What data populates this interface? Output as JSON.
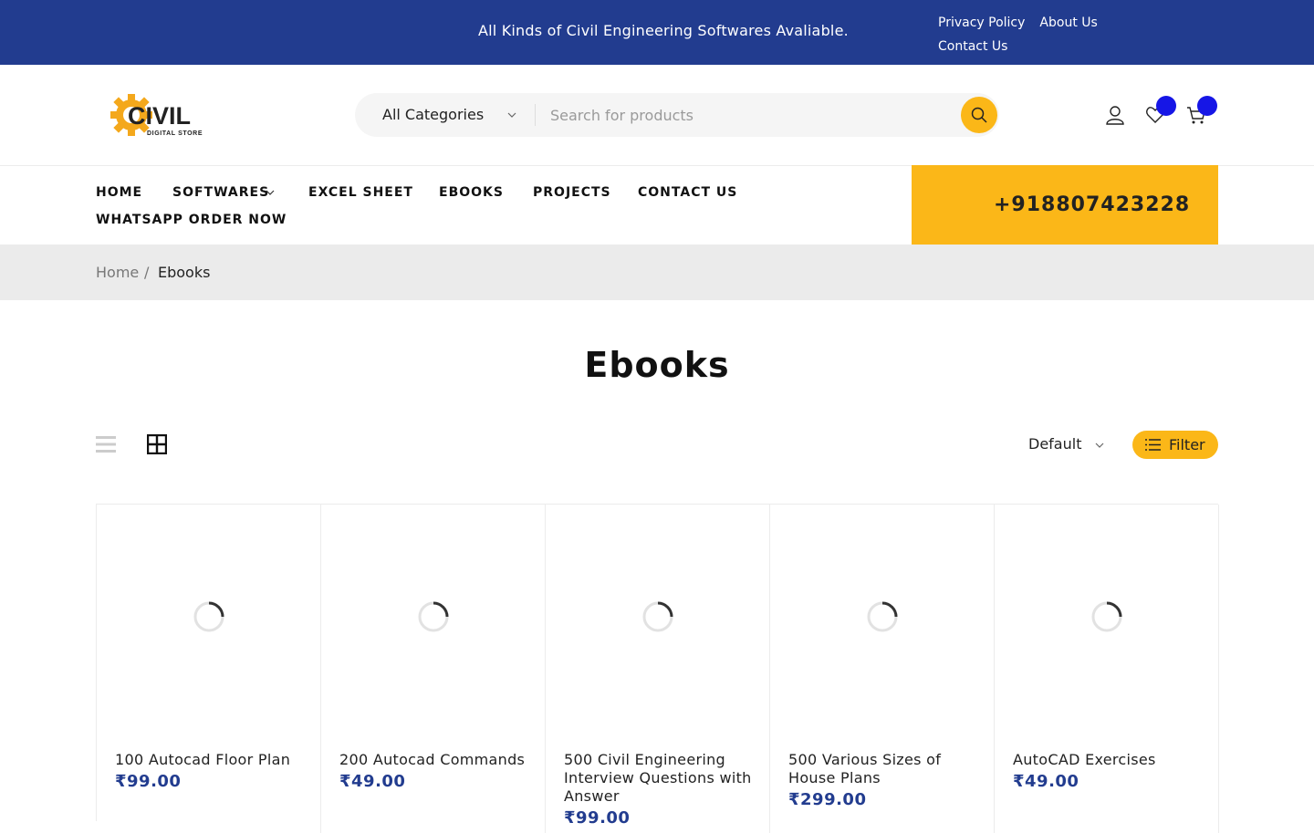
{
  "topbar": {
    "message": "All Kinds of Civil Engineering Softwares Avaliable.",
    "links": [
      "Privacy Policy",
      "About Us",
      "Contact Us"
    ],
    "bg_color": "#223c8f"
  },
  "header": {
    "logo": {
      "main": "CIVIL",
      "sub": "DIGITAL STORE"
    },
    "search": {
      "category": "All Categories",
      "placeholder": "Search for products",
      "button_icon": "search-icon"
    },
    "icons": [
      "user-icon",
      "heart-icon",
      "cart-icon"
    ],
    "accent_color": "#fbb718",
    "badge_color": "#1616e6"
  },
  "nav": {
    "items": [
      "HOME",
      "SOFTWARES",
      "EXCEL SHEET",
      "EBOOKS",
      "PROJECTS",
      "CONTACT US",
      "WHATSAPP ORDER NOW"
    ],
    "phone": "+918807423228"
  },
  "breadcrumb": {
    "home": "Home",
    "separator": "/",
    "current": "Ebooks"
  },
  "page": {
    "title": "Ebooks"
  },
  "toolbar": {
    "sort": "Default",
    "filter_label": "Filter",
    "view_modes": [
      "list-view-icon",
      "grid-view-icon"
    ],
    "active_view": "grid"
  },
  "products": [
    {
      "name": "100 Autocad Floor Plan",
      "price": "₹99.00"
    },
    {
      "name": "200 Autocad Commands",
      "price": "₹49.00"
    },
    {
      "name": "500 Civil Engineering Interview Questions with Answer",
      "price": "₹99.00"
    },
    {
      "name": "500 Various Sizes of House Plans",
      "price": "₹299.00"
    },
    {
      "name": "AutoCAD Exercises",
      "price": "₹49.00"
    }
  ]
}
